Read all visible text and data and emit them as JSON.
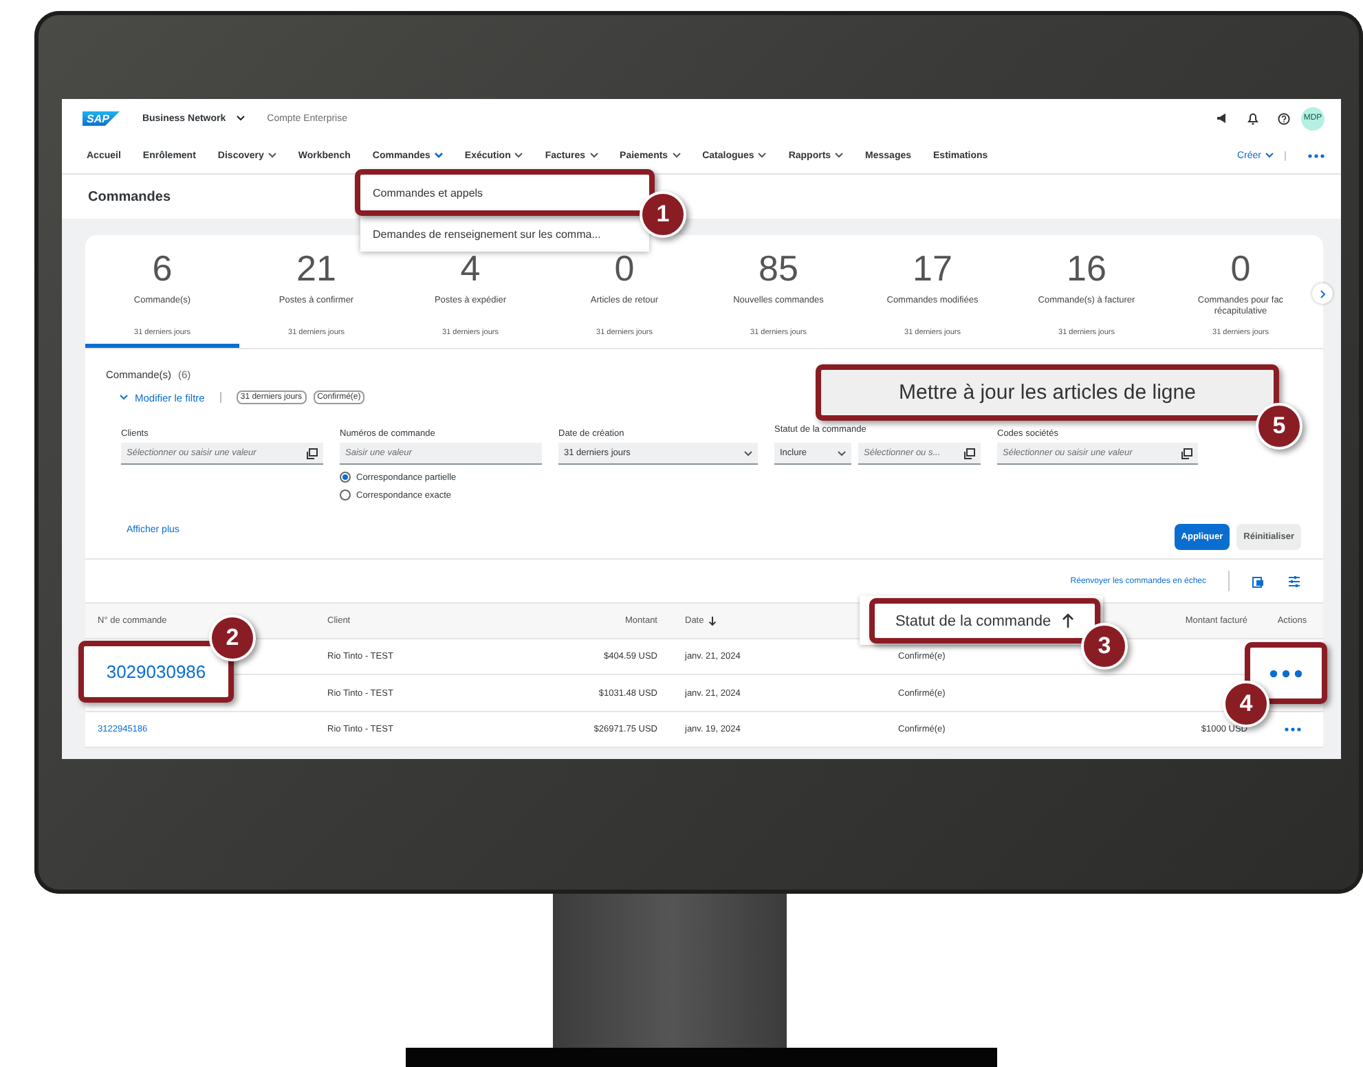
{
  "header": {
    "logo": "SAP",
    "app": "Business Network",
    "account": "Compte Enterprise",
    "avatar": "MDP"
  },
  "nav": {
    "items": [
      {
        "label": "Accueil",
        "has_menu": false
      },
      {
        "label": "Enrôlement",
        "has_menu": false
      },
      {
        "label": "Discovery",
        "has_menu": true
      },
      {
        "label": "Workbench",
        "has_menu": false
      },
      {
        "label": "Commandes",
        "has_menu": true,
        "open": true
      },
      {
        "label": "Exécution",
        "has_menu": true,
        "open": false
      },
      {
        "label": "Factures",
        "has_menu": true,
        "open": false
      },
      {
        "label": "Paiements",
        "has_menu": true,
        "open": false
      },
      {
        "label": "Catalogues",
        "has_menu": true,
        "open": false
      },
      {
        "label": "Rapports",
        "has_menu": true,
        "open": false
      },
      {
        "label": "Messages",
        "has_menu": false
      },
      {
        "label": "Estimations",
        "has_menu": false
      }
    ],
    "create": "Créer"
  },
  "page_title": "Commandes",
  "dropdown": {
    "items": [
      {
        "label": "Commandes et appels",
        "outlined": true
      },
      {
        "label": "Demandes de renseignement sur les comma...",
        "outlined": false
      }
    ]
  },
  "tiles": [
    {
      "value": "6",
      "label": "Commande(s)",
      "period": "31 derniers jours",
      "selected": true
    },
    {
      "value": "21",
      "label": "Postes à confirmer",
      "period": "31 derniers jours",
      "selected": false
    },
    {
      "value": "4",
      "label": "Postes à expédier",
      "period": "31 derniers jours",
      "selected": false
    },
    {
      "value": "0",
      "label": "Articles de retour",
      "period": "31 derniers jours",
      "selected": false
    },
    {
      "value": "85",
      "label": "Nouvelles commandes",
      "period": "31 derniers jours",
      "selected": false
    },
    {
      "value": "17",
      "label": "Commandes modifiées",
      "period": "31 derniers jours",
      "selected": false
    },
    {
      "value": "16",
      "label": "Commande(s) à facturer",
      "period": "31 derniers jours",
      "selected": false
    },
    {
      "value": "0",
      "label": "Commandes pour fac\nrécapitulative",
      "period": "31 derniers jours",
      "selected": false
    }
  ],
  "filter": {
    "title": "Commande(s)",
    "count": "(6)",
    "toggle": "Modifier le filtre",
    "chips": [
      "31 derniers jours",
      "Confirmé(e)"
    ],
    "fields": [
      {
        "kind": "input",
        "label": "Clients",
        "placeholder": "Sélectionner ou saisir une valeur"
      },
      {
        "kind": "text",
        "label": "Numéros de commande",
        "placeholder": "Saisir une valeur",
        "options": [
          {
            "label": "Correspondance partielle",
            "selected": true
          },
          {
            "label": "Correspondance exacte",
            "selected": false
          }
        ]
      },
      {
        "kind": "select",
        "label": "Date de création",
        "value": "31 derniers jours"
      },
      {
        "kind": "combo",
        "label": "Statut de la commande",
        "value": "Inclure",
        "placeholder": "Sélectionner ou s..."
      },
      {
        "kind": "input",
        "label": "Codes sociétés",
        "placeholder": "Sélectionner ou saisir une valeur"
      }
    ],
    "more": "Afficher plus",
    "apply": "Appliquer",
    "reset": "Réinitialiser"
  },
  "table": {
    "resend": "Réenvoyer les commandes en échec",
    "columns": [
      {
        "label": "N° de commande"
      },
      {
        "label": "Client"
      },
      {
        "label": "Montant"
      },
      {
        "label": "Date",
        "sorted": true
      },
      {},
      {
        "label": "Montant facturé"
      },
      {
        "label": "Actions"
      }
    ],
    "rows": [
      {
        "client": "Rio Tinto - TEST",
        "amount": "$404.59 USD",
        "date": "janv. 21, 2024",
        "status": "Confirmé(e)"
      },
      {
        "client": "Rio Tinto - TEST",
        "amount": "$1031.48 USD",
        "date": "janv. 21, 2024",
        "status": "Confirmé(e)"
      },
      {
        "order": "3122945186",
        "client": "Rio Tinto - TEST",
        "amount": "$26971.75 USD",
        "date": "janv. 19, 2024",
        "status": "Confirmé(e)",
        "billed": "$1000 USD",
        "has_actions": true
      }
    ]
  },
  "callouts": [
    {
      "number": "1",
      "kind": "frame"
    },
    {
      "number": "5",
      "kind": "label",
      "text": "Mettre à jour les articles de ligne"
    },
    {
      "number": "2",
      "kind": "link",
      "text": "3029030986"
    },
    {
      "number": "3",
      "kind": "sort",
      "text": "Statut de la commande"
    },
    {
      "number": "4",
      "kind": "dots"
    }
  ]
}
